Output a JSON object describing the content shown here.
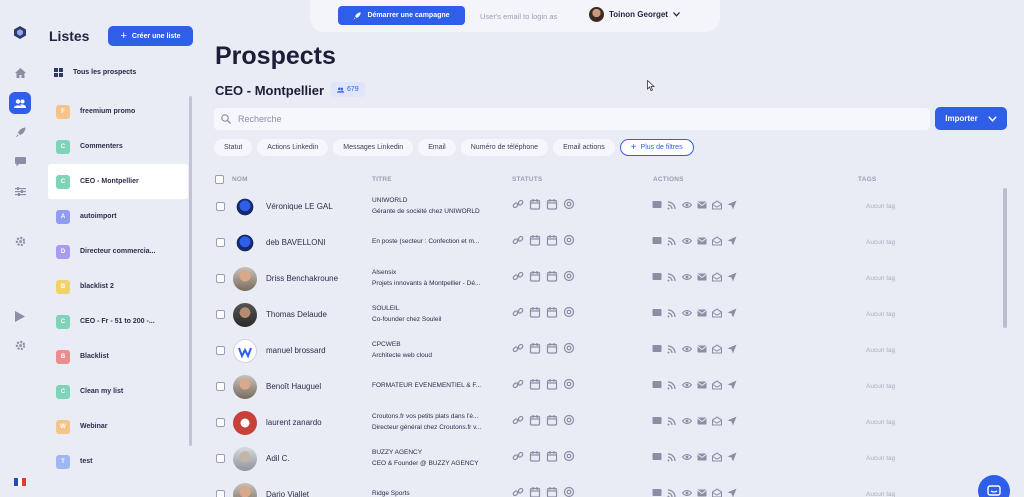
{
  "sidebar_rail": {
    "items": [
      "logo-icon",
      "home-icon",
      "users-icon",
      "rocket-icon",
      "chat-icon",
      "sliders-icon",
      "settings-icon",
      "play-icon",
      "gear-icon"
    ],
    "active": "users-icon",
    "flag": "fr"
  },
  "lists_panel": {
    "title": "Listes",
    "create_button": "Créer une liste",
    "all_prospects": "Tous les prospects",
    "items": [
      {
        "letter": "F",
        "label": "freemium promo",
        "color": "#f5c48a"
      },
      {
        "letter": "C",
        "label": "Commenters",
        "color": "#7fd3b8"
      },
      {
        "letter": "C",
        "label": "CEO - Montpellier",
        "color": "#7fd3b8",
        "selected": true
      },
      {
        "letter": "A",
        "label": "autoimport",
        "color": "#8f9cf2"
      },
      {
        "letter": "D",
        "label": "Directeur commercia...",
        "color": "#a99cf0"
      },
      {
        "letter": "B",
        "label": "blacklist 2",
        "color": "#f2d36a"
      },
      {
        "letter": "C",
        "label": "CEO - Fr - 51 to 200 -...",
        "color": "#7fd3b8"
      },
      {
        "letter": "B",
        "label": "Blacklist",
        "color": "#f08a8f"
      },
      {
        "letter": "C",
        "label": "Clean my list",
        "color": "#7fd3b8"
      },
      {
        "letter": "W",
        "label": "Webinar",
        "color": "#f5c48a"
      },
      {
        "letter": "T",
        "label": "test",
        "color": "#9fb6f2"
      }
    ]
  },
  "topbar": {
    "campaign_button": "Démarrer une campagne",
    "login_placeholder": "User's email to login as",
    "user_name": "Toinon Georget"
  },
  "main": {
    "title": "Prospects",
    "list_name": "CEO - Montpellier",
    "count": "679",
    "search_placeholder": "Recherche",
    "import_button": "Importer",
    "filters": [
      "Statut",
      "Actions Linkedin",
      "Messages Linkedin",
      "Email",
      "Numéro de téléphone",
      "Email actions"
    ],
    "more_filters": "Plus de filtres",
    "columns": {
      "name": "NOM",
      "title": "TITRE",
      "status": "STATUTS",
      "actions": "ACTIONS",
      "tags": "TAGS"
    },
    "rows": [
      {
        "name": "Véronique LE GAL",
        "company": "UNIWORLD",
        "role": "Gérante de société chez UNIWORLD",
        "avatar": "alien",
        "tag": "Aucun tag"
      },
      {
        "name": "deb BAVELLONI",
        "company": "En poste (secteur : Confection et m...",
        "role": "",
        "avatar": "alien",
        "tag": "Aucun tag"
      },
      {
        "name": "Driss Benchakroune",
        "company": "Alsensix",
        "role": "Projets innovants à Montpellier - Dé...",
        "avatar": "photo",
        "tag": "Aucun tag"
      },
      {
        "name": "Thomas Delaude",
        "company": "SOULEIL",
        "role": "Co-founder chez Souleil",
        "avatar": "photo-dark",
        "tag": "Aucun tag"
      },
      {
        "name": "manuel brossard",
        "company": "CPCWEB",
        "role": "Architecte web cloud",
        "avatar": "logo-w",
        "tag": "Aucun tag"
      },
      {
        "name": "Benoît Hauguel",
        "company": "FORMATEUR ÉVÉNEMENTIEL & F...",
        "role": "",
        "avatar": "photo",
        "tag": "Aucun tag"
      },
      {
        "name": "laurent zanardo",
        "company": "Croutons.fr vos petits plats dans l'é...",
        "role": "Directeur général chez Croutons.fr v...",
        "avatar": "logo-red",
        "tag": "Aucun tag"
      },
      {
        "name": "Adil C.",
        "company": "BUZZY AGENCY",
        "role": "CEO & Founder @ BUZZY AGENCY",
        "avatar": "photo-grey",
        "tag": "Aucun tag"
      },
      {
        "name": "Dario Viallet",
        "company": "Ridge Sports",
        "role": "",
        "avatar": "photo",
        "tag": "Aucun tag"
      }
    ]
  },
  "colors": {
    "accent": "#2f5fe8",
    "background": "#e9ebf5"
  }
}
